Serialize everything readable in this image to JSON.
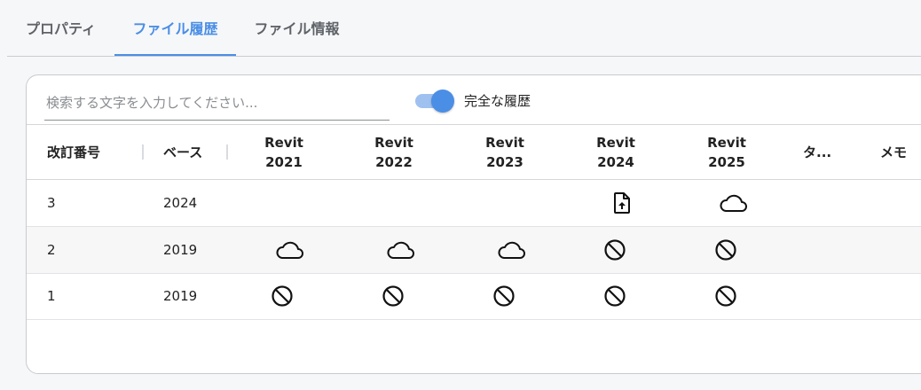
{
  "tabs": [
    {
      "label": "プロパティ",
      "active": false
    },
    {
      "label": "ファイル履歴",
      "active": true
    },
    {
      "label": "ファイル情報",
      "active": false
    }
  ],
  "search": {
    "placeholder": "検索する文字を入力してください...",
    "value": ""
  },
  "toggle": {
    "label": "完全な履歴",
    "on": true
  },
  "colors": {
    "accent": "#4a8ee6",
    "toggle_track": "#9ec1f0"
  },
  "table": {
    "headers": {
      "revision": "改訂番号",
      "base": "ベース",
      "revit2021": [
        "Revit",
        "2021"
      ],
      "revit2022": [
        "Revit",
        "2022"
      ],
      "revit2023": [
        "Revit",
        "2023"
      ],
      "revit2024": [
        "Revit",
        "2024"
      ],
      "revit2025": [
        "Revit",
        "2025"
      ],
      "tag": "タ...",
      "memo": "メモ"
    },
    "rows": [
      {
        "revision": "3",
        "base": "2024",
        "status": [
          "",
          "",
          "",
          "file-upload-icon",
          "cloud-icon"
        ]
      },
      {
        "revision": "2",
        "base": "2019",
        "status": [
          "cloud-icon",
          "cloud-icon",
          "cloud-icon",
          "blocked-icon",
          "blocked-icon"
        ]
      },
      {
        "revision": "1",
        "base": "2019",
        "status": [
          "blocked-icon",
          "blocked-icon",
          "blocked-icon",
          "blocked-icon",
          "blocked-icon"
        ]
      }
    ]
  }
}
